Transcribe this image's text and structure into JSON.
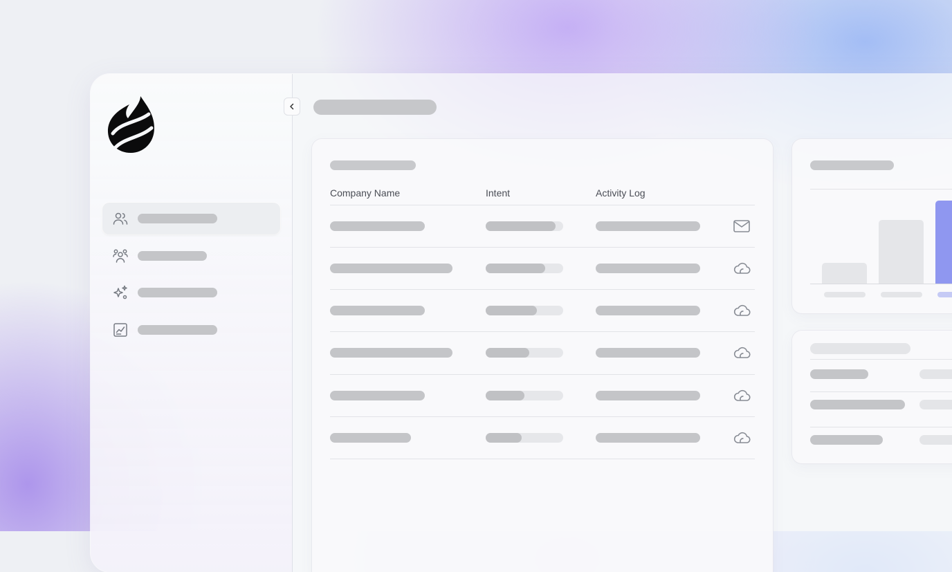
{
  "app": {
    "logo_icon": "flame-logo-icon",
    "accent_color": "#8f97f0"
  },
  "sidebar": {
    "collapse_icon": "chevron-left-icon",
    "items": [
      {
        "icon": "users-icon",
        "active": true
      },
      {
        "icon": "people-group-icon",
        "active": false
      },
      {
        "icon": "sparkles-icon",
        "active": false
      },
      {
        "icon": "chart-report-icon",
        "active": false
      }
    ]
  },
  "table": {
    "columns": [
      "Company Name",
      "Intent",
      "Activity Log"
    ],
    "rows": [
      {
        "intent_level": 0.9,
        "action_icon": "mail-icon"
      },
      {
        "intent_level": 0.77,
        "action_icon": "cloud-icon"
      },
      {
        "intent_level": 0.66,
        "action_icon": "cloud-icon"
      },
      {
        "intent_level": 0.56,
        "action_icon": "cloud-icon"
      },
      {
        "intent_level": 0.5,
        "action_icon": "cloud-icon"
      },
      {
        "intent_level": 0.46,
        "action_icon": "cloud-icon"
      }
    ]
  },
  "chart_data": {
    "type": "bar",
    "title": "",
    "xlabel": "",
    "ylabel": "",
    "categories": [
      "",
      "",
      ""
    ],
    "values": [
      0.25,
      0.77,
      1.0
    ],
    "ylim": [
      0,
      1
    ],
    "grid": false,
    "bar_colors": [
      "#e5e6e9",
      "#e5e6e9",
      "#8f97f0"
    ]
  }
}
